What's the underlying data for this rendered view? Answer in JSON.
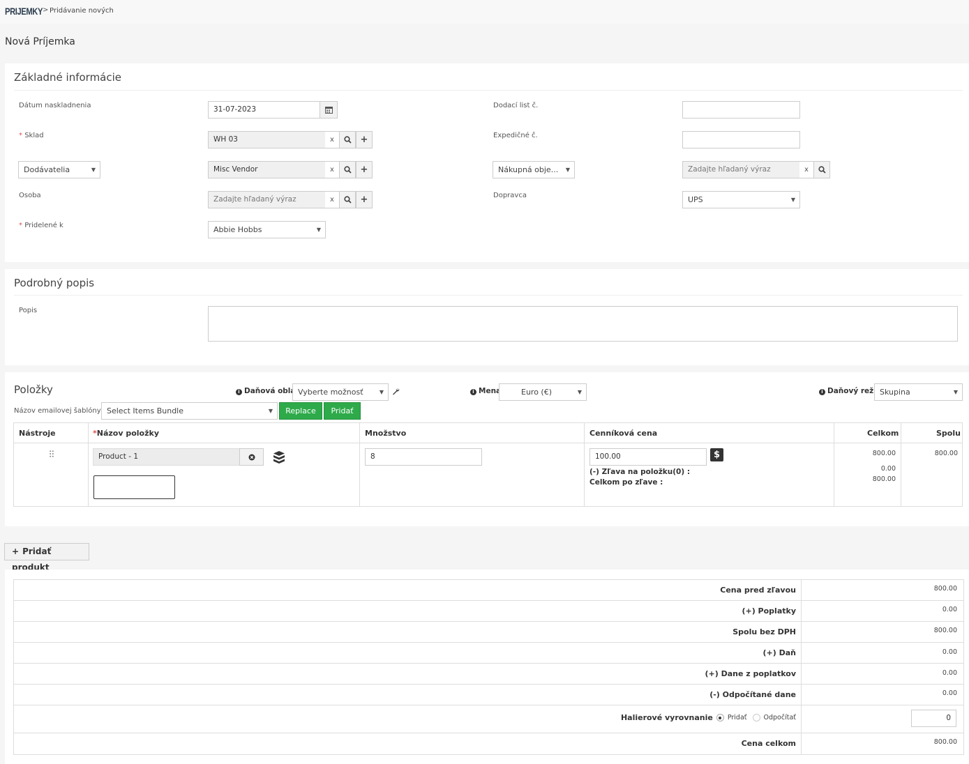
{
  "breadcrumb": {
    "root": "PRIJEMKY",
    "sep": ">",
    "current": "Pridávanie nových"
  },
  "page_title": "Nová Príjemka",
  "basic": {
    "title": "Základné informácie",
    "date_label": "Dátum naskladnenia",
    "date_value": "31-07-2023",
    "warehouse_label": "Sklad",
    "warehouse_value": "WH 03",
    "vendor_type": "Dodávatelia",
    "vendor_value": "Misc Vendor",
    "person_label": "Osoba",
    "person_placeholder": "Zadajte hľadaný výraz",
    "assigned_label": "Pridelené k",
    "assigned_value": "Abbie Hobbs",
    "delivery_label": "Dodací list č.",
    "delivery_value": "",
    "shipping_label": "Expedičné č.",
    "shipping_value": "",
    "po_select": "Nákupná obje...",
    "po_placeholder": "Zadajte hľadaný výraz",
    "carrier_label": "Dopravca",
    "carrier_value": "UPS",
    "clear": "x"
  },
  "description": {
    "title": "Podrobný popis",
    "label": "Popis",
    "value": ""
  },
  "items": {
    "title": "Položky",
    "tax_area_label": "Daňová oblasť",
    "tax_area_value": "Vyberte možnosť",
    "currency_label": "Mena",
    "currency_value": "Euro (€)",
    "tax_mode_label": "Daňový režim",
    "tax_mode_value": "Skupina",
    "template_label": "Názov emailovej šablóny:",
    "bundle_value": "Select Items Bundle",
    "replace_btn": "Replace",
    "add_btn": "Pridať",
    "columns": {
      "tools": "Nástroje",
      "name": "Názov položky",
      "qty": "Množstvo",
      "price": "Cenníková cena",
      "total": "Celkom",
      "net": "Spolu"
    },
    "row": {
      "product": "Product - 1",
      "qty": "8",
      "price": "100.00",
      "discount_label": "(-) Zľava na položku(0) :",
      "after_discount_label": "Celkom po zľave :",
      "total": "800.00",
      "discount": "0.00",
      "after_discount": "800.00",
      "net": "800.00"
    },
    "add_product_btn": "Pridať produkt"
  },
  "summary": {
    "rows": [
      {
        "label": "Cena pred zľavou",
        "value": "800.00"
      },
      {
        "label": "(+) Poplatky",
        "value": "0.00"
      },
      {
        "label": "Spolu bez DPH",
        "value": "800.00"
      },
      {
        "label": "(+) Daň",
        "value": "0.00"
      },
      {
        "label": "(+) Dane z poplatkov",
        "value": "0.00"
      },
      {
        "label": "(-) Odpočítané dane",
        "value": "0.00"
      }
    ],
    "rounding_label": "Halierové vyrovnanie",
    "rounding_add": "Pridať",
    "rounding_sub": "Odpočítať",
    "rounding_value": "0",
    "grand_label": "Cena celkom",
    "grand_value": "800.00"
  }
}
